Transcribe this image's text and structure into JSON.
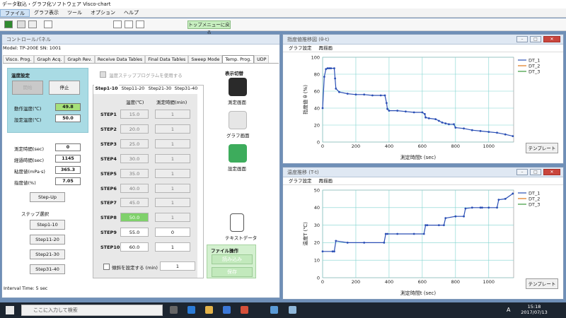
{
  "app": {
    "title": "データ取込・グラフ化ソフトウェア Visco-chart"
  },
  "menu": [
    "ファイル",
    "グラフ表示",
    "ツール",
    "オプション",
    "ヘルプ"
  ],
  "toolbar": {
    "top_menu_label": "トップメニューに戻る"
  },
  "control_panel": {
    "title": "コントロールパネル",
    "model_info": "Model: TP-200E   SN: 1001",
    "tabs": [
      "Visco. Prog.",
      "Graph Acq.",
      "Graph Rev.",
      "Receive Data Tables",
      "Final Data Tables",
      "Sweep Mode",
      "Temp. Prog.",
      "UDP"
    ],
    "active_tab": "Temp. Prog.",
    "temp_setting": {
      "title": "温度設定",
      "start_label": "開始",
      "stop_label": "停止",
      "operating_temp_label": "動作温度(℃)",
      "operating_temp_value": "49.8",
      "set_temp_label": "設定温度(℃)",
      "set_temp_value": "50.0"
    },
    "readings": [
      {
        "label": "測定時間(sec)",
        "value": "0"
      },
      {
        "label": "経過時間(sec)",
        "value": "1145"
      },
      {
        "label": "粘度値(mPa·s)",
        "value": "365.3"
      },
      {
        "label": "指度値(%)",
        "value": "7.05"
      }
    ],
    "step_up_label": "Step-Up",
    "step_select": {
      "title": "ステップ選択",
      "buttons": [
        "Step1-10",
        "Step11-20",
        "Step21-30",
        "Step31-40"
      ]
    },
    "use_program_label": "温度ステッププログラムを使用する",
    "step_tabs": [
      "Step1-10",
      "Step11-20",
      "Step21-30",
      "Step31-40"
    ],
    "col_temp": "温度(℃)",
    "col_time": "測定時間(min)",
    "steps": [
      {
        "name": "STEP1",
        "temp": "15.0",
        "time": "1"
      },
      {
        "name": "STEP2",
        "temp": "20.0",
        "time": "1"
      },
      {
        "name": "STEP3",
        "temp": "25.0",
        "time": "1"
      },
      {
        "name": "STEP4",
        "temp": "30.0",
        "time": "1"
      },
      {
        "name": "STEP5",
        "temp": "35.0",
        "time": "1"
      },
      {
        "name": "STEP6",
        "temp": "40.0",
        "time": "1"
      },
      {
        "name": "STEP7",
        "temp": "45.0",
        "time": "1"
      },
      {
        "name": "STEP8",
        "temp": "50.0",
        "time": "1"
      },
      {
        "name": "STEP9",
        "temp": "55.0",
        "time": "0"
      },
      {
        "name": "STEP10",
        "temp": "60.0",
        "time": "1"
      }
    ],
    "slope_label": "傾斜を設定する (min)",
    "slope_value": "1",
    "display_switch": {
      "title": "表示切替",
      "items": [
        "測定画面",
        "グラフ画面",
        "設定画面",
        "テキストデータ"
      ]
    },
    "file_ops": {
      "title": "ファイル操作",
      "load": "読み込み",
      "save": "保存"
    },
    "status": "Interval Time: 5 sec"
  },
  "graph_menu": {
    "settings": "グラフ設定",
    "redraw": "再描画"
  },
  "template_label": "テンプレート",
  "chart_data": [
    {
      "type": "line",
      "title": "指度値推移図 (θ-t)",
      "xlabel": "測定時間t (sec)",
      "ylabel": "指度値 θ (%)",
      "xlim": [
        0,
        1150
      ],
      "ylim": [
        0,
        100
      ],
      "xticks": [
        0,
        200,
        400,
        600,
        800,
        1000
      ],
      "yticks": [
        0,
        20,
        40,
        60,
        80,
        100
      ],
      "legend": "top-right",
      "series": [
        {
          "name": "DT_1",
          "color": "#2a4fb5",
          "x": [
            0,
            10,
            20,
            30,
            40,
            50,
            70,
            75,
            80,
            100,
            150,
            200,
            250,
            300,
            350,
            375,
            385,
            390,
            400,
            450,
            500,
            550,
            600,
            615,
            620,
            640,
            680,
            700,
            720,
            740,
            760,
            790,
            800,
            850,
            900,
            950,
            1000,
            1050,
            1100,
            1145
          ],
          "y": [
            40,
            77,
            86,
            87,
            87,
            87,
            87,
            75,
            63,
            59,
            57,
            56,
            56,
            55,
            55,
            55,
            46,
            39,
            37,
            37,
            36,
            35,
            35,
            33,
            29,
            28,
            27,
            25,
            23,
            22,
            21,
            21,
            17,
            16,
            14,
            13,
            12,
            11,
            9,
            7
          ]
        },
        {
          "name": "DT_2",
          "color": "#e0781a",
          "x": [],
          "y": []
        },
        {
          "name": "DT_3",
          "color": "#3a9a3a",
          "x": [],
          "y": []
        }
      ]
    },
    {
      "type": "line",
      "title": "温度推移 (T-t)",
      "xlabel": "測定時間t (sec)",
      "ylabel": "温度T (℃)",
      "xlim": [
        0,
        1150
      ],
      "ylim": [
        0,
        50
      ],
      "xticks": [
        0,
        200,
        400,
        600,
        800,
        1000
      ],
      "yticks": [
        0,
        10,
        20,
        30,
        40,
        50
      ],
      "legend": "top-right",
      "series": [
        {
          "name": "DT_1",
          "color": "#2a4fb5",
          "x": [
            0,
            60,
            70,
            80,
            150,
            250,
            370,
            380,
            390,
            450,
            550,
            610,
            620,
            630,
            700,
            730,
            740,
            800,
            850,
            860,
            900,
            950,
            960,
            1000,
            1050,
            1060,
            1100,
            1145
          ],
          "y": [
            15,
            15,
            15,
            21,
            20,
            20,
            20,
            25,
            25,
            25,
            25,
            25,
            30,
            30,
            30,
            30,
            34,
            35,
            35,
            39.5,
            40,
            40,
            40,
            40,
            40,
            44.5,
            45,
            48
          ]
        },
        {
          "name": "DT_2",
          "color": "#e0781a",
          "x": [],
          "y": []
        },
        {
          "name": "DT_3",
          "color": "#3a9a3a",
          "x": [],
          "y": []
        }
      ]
    }
  ],
  "taskbar": {
    "search_placeholder": "ここに入力して検索",
    "time": "15:18",
    "date": "2017/07/13",
    "ime": "A"
  }
}
